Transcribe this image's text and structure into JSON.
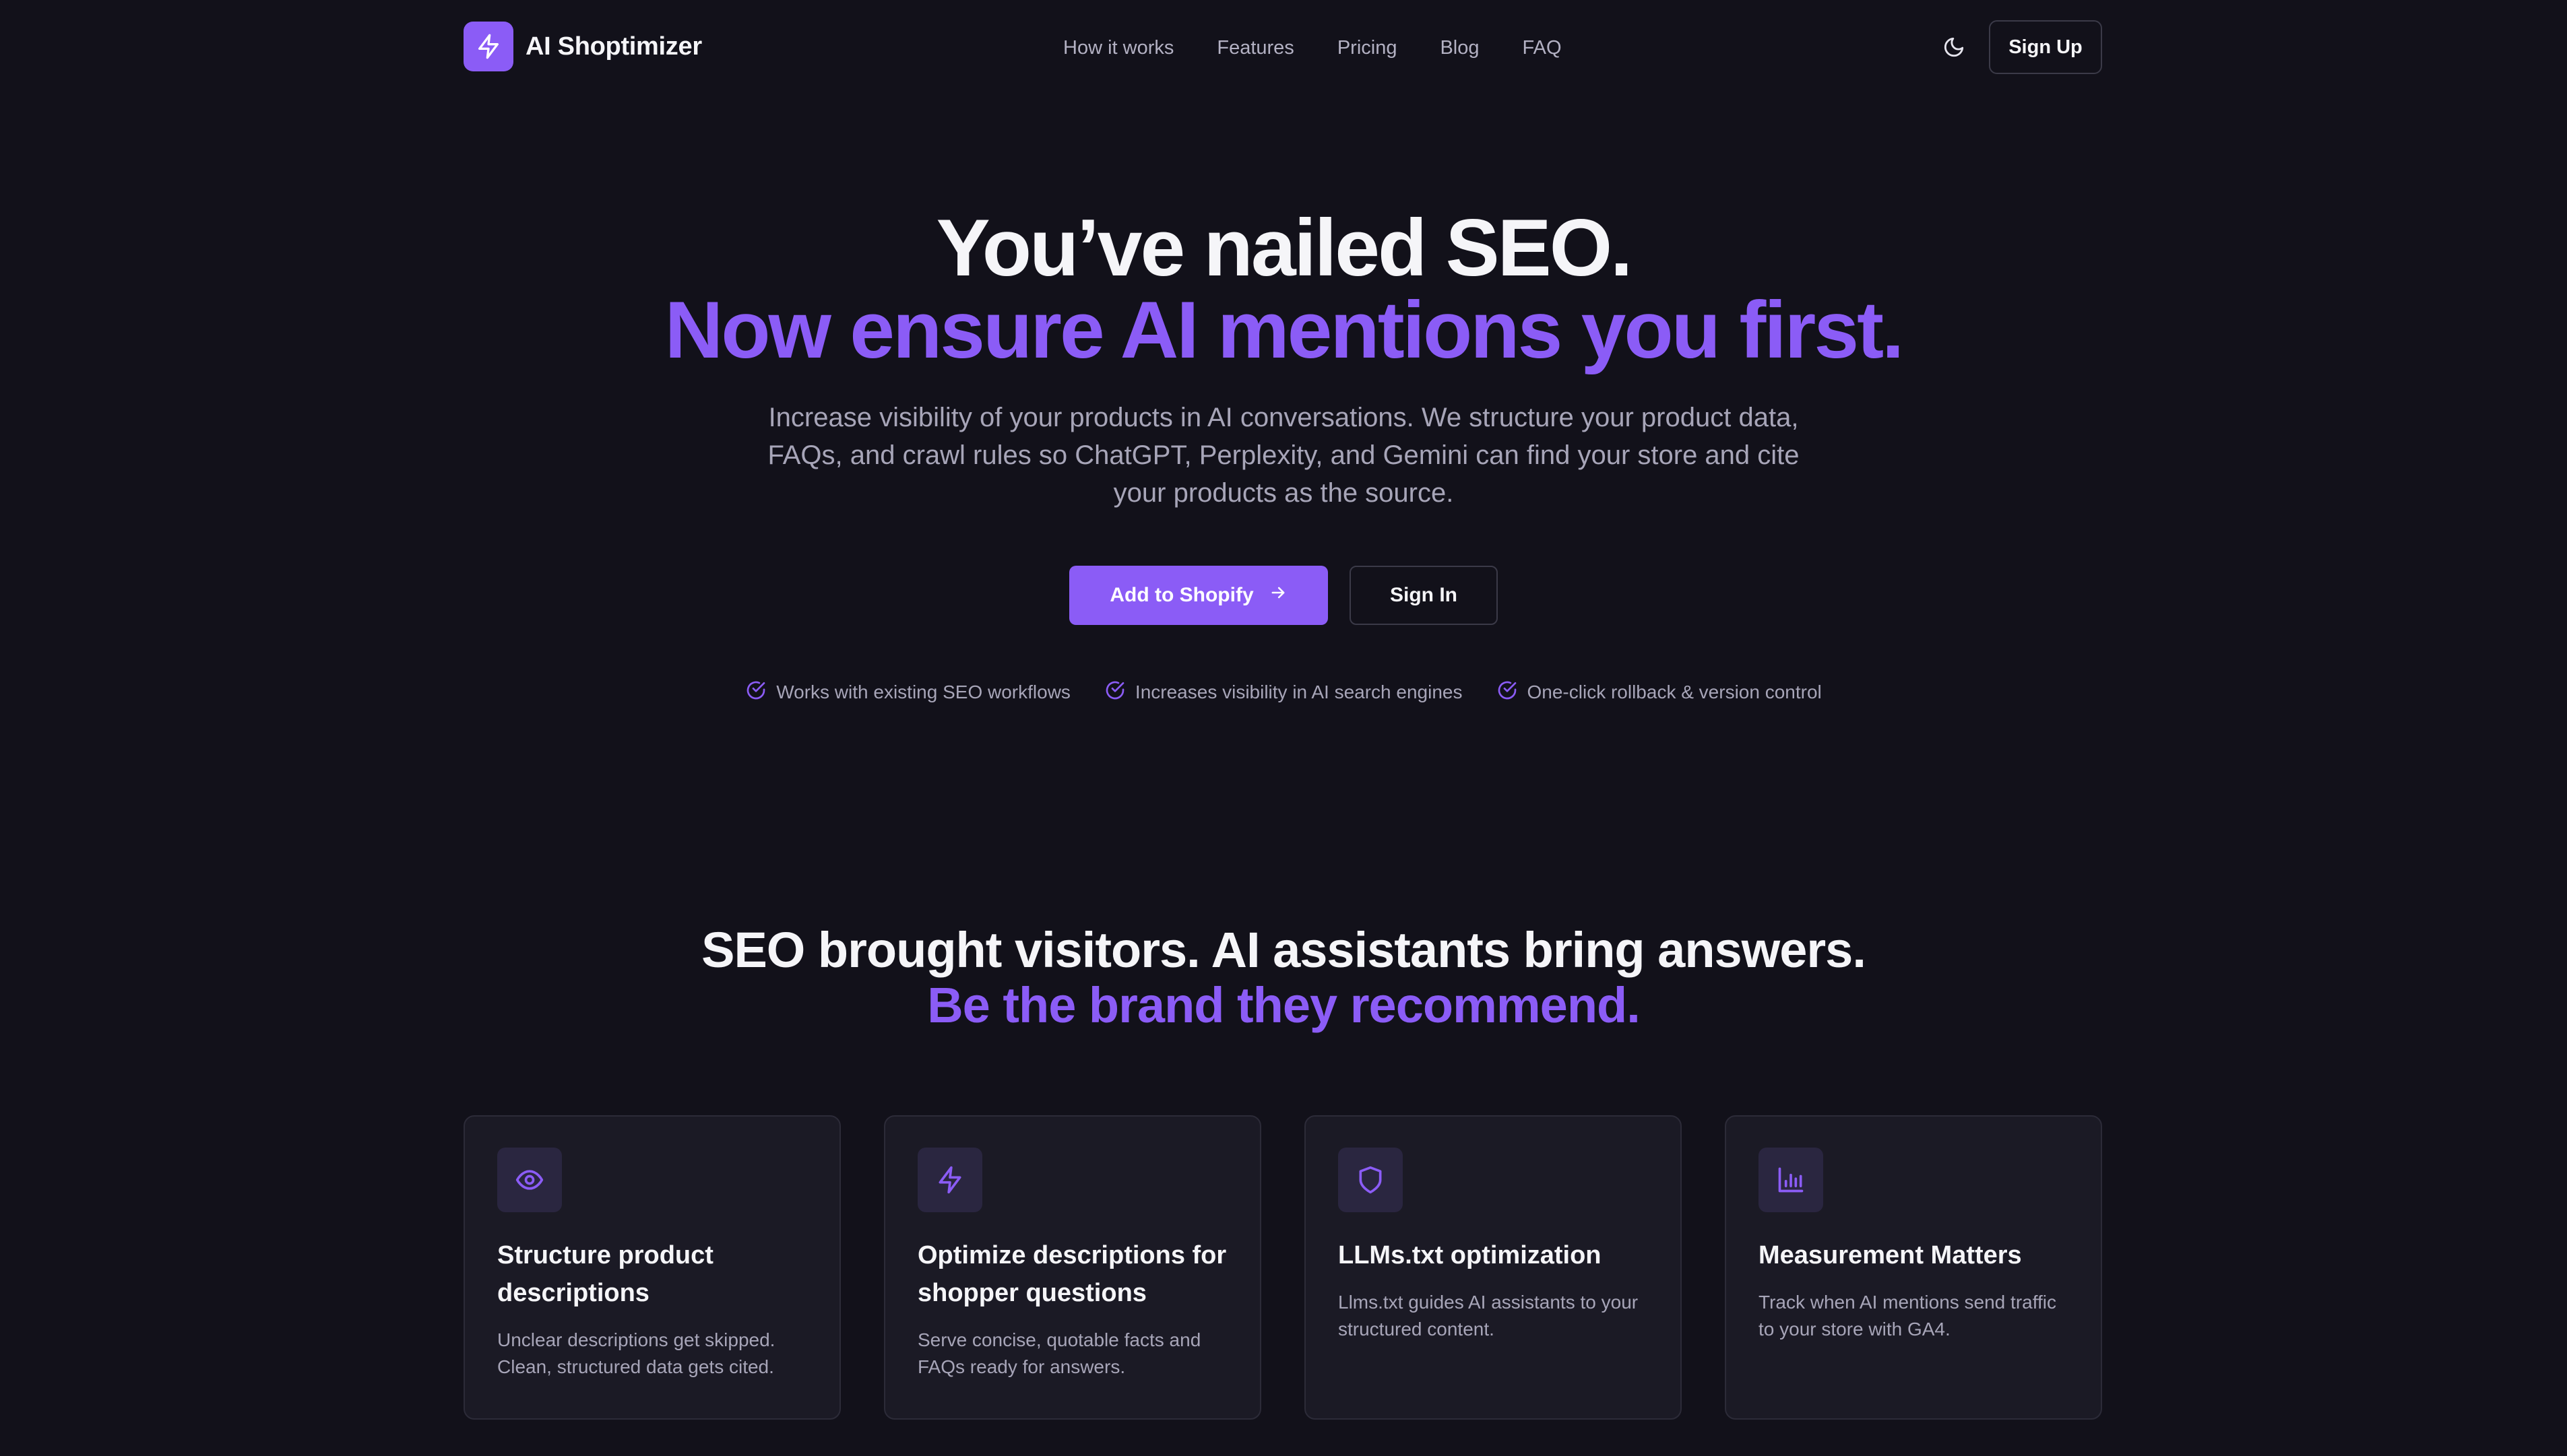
{
  "colors": {
    "background": "#12111a",
    "accent": "#8b5cf6",
    "card_bg": "#1b1a25",
    "muted_text": "#a7a5b8"
  },
  "brand": {
    "name": "AI Shoptimizer",
    "logo_icon": "lightning-bolt-icon"
  },
  "nav": {
    "links": [
      "How it works",
      "Features",
      "Pricing",
      "Blog",
      "FAQ"
    ],
    "theme_toggle_icon": "moon-icon",
    "signup_label": "Sign Up"
  },
  "hero": {
    "title_line1": "You’ve nailed SEO.",
    "title_line2": "Now ensure AI mentions you first.",
    "subtitle": "Increase visibility of your products in AI conversations. We structure your product data, FAQs, and crawl rules so ChatGPT, Perplexity, and Gemini can find your store and cite your products as the source.",
    "primary_cta": "Add to Shopify",
    "primary_cta_icon": "arrow-right-icon",
    "secondary_cta": "Sign In",
    "checks": [
      "Works with existing SEO workflows",
      "Increases visibility in AI search engines",
      "One-click rollback & version control"
    ]
  },
  "section": {
    "title_line1": "SEO brought visitors. AI assistants bring answers.",
    "title_line2": "Be the brand they recommend.",
    "cards": [
      {
        "icon": "eye-icon",
        "title": "Structure product descriptions",
        "description": "Unclear descriptions get skipped. Clean, structured data gets cited."
      },
      {
        "icon": "lightning-bolt-icon",
        "title": "Optimize descriptions for shopper questions",
        "description": "Serve concise, quotable facts and FAQs ready for answers."
      },
      {
        "icon": "shield-icon",
        "title": "LLMs.txt optimization",
        "description": "Llms.txt guides AI assistants to your structured content."
      },
      {
        "icon": "bar-chart-icon",
        "title": "Measurement Matters",
        "description": "Track when AI mentions send traffic to your store with GA4."
      }
    ]
  }
}
